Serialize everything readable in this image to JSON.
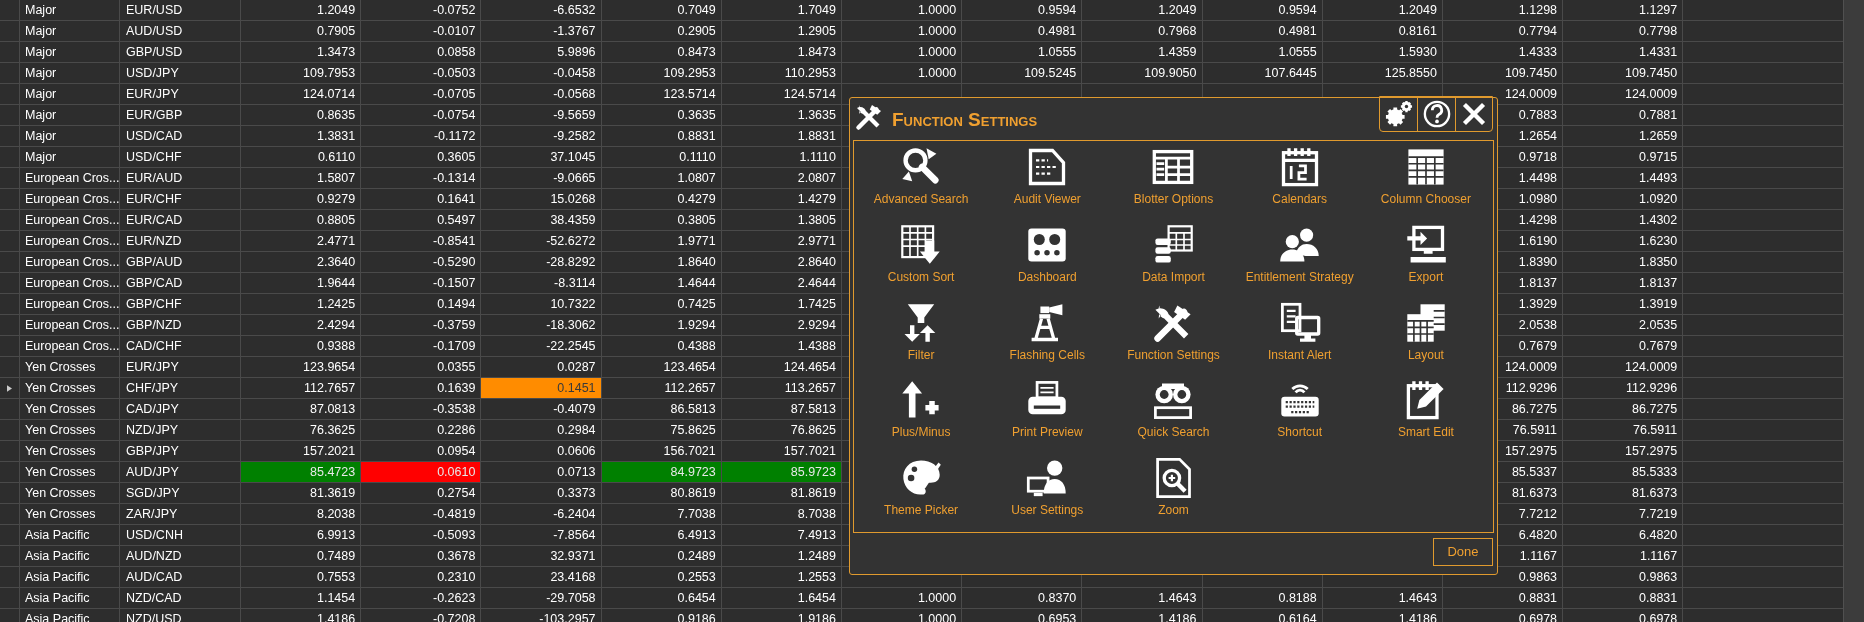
{
  "table": {
    "rows": [
      {
        "category": "Major",
        "pair": "EUR/USD",
        "selected": false,
        "values": [
          "1.2049",
          "-0.0752",
          "-6.6532",
          "0.7049",
          "1.7049"
        ],
        "middle_values": [
          "1.0000",
          "0.9594",
          "1.2049",
          "0.9594",
          "1.2049"
        ],
        "right_values": [
          "1.1298",
          "1.1297"
        ]
      },
      {
        "category": "Major",
        "pair": "AUD/USD",
        "selected": false,
        "values": [
          "0.7905",
          "-0.0107",
          "-1.3767",
          "0.2905",
          "1.2905"
        ],
        "middle_values": [
          "1.0000",
          "0.4981",
          "0.7968",
          "0.4981",
          "0.8161"
        ],
        "right_values": [
          "0.7794",
          "0.7798"
        ]
      },
      {
        "category": "Major",
        "pair": "GBP/USD",
        "selected": false,
        "values": [
          "1.3473",
          "0.0858",
          "5.9896",
          "0.8473",
          "1.8473"
        ],
        "middle_values": [
          "1.0000",
          "1.0555",
          "1.4359",
          "1.0555",
          "1.5930"
        ],
        "right_values": [
          "1.4333",
          "1.4331"
        ]
      },
      {
        "category": "Major",
        "pair": "USD/JPY",
        "selected": false,
        "values": [
          "109.7953",
          "-0.0503",
          "-0.0458",
          "109.2953",
          "110.2953"
        ],
        "middle_values": [
          "1.0000",
          "109.5245",
          "109.9050",
          "107.6445",
          "125.8550"
        ],
        "right_values": [
          "109.7450",
          "109.7450"
        ]
      },
      {
        "category": "Major",
        "pair": "EUR/JPY",
        "selected": false,
        "values": [
          "124.0714",
          "-0.0705",
          "-0.0568",
          "123.5714",
          "124.5714"
        ],
        "right_values": [
          "124.0009",
          "124.0009"
        ]
      },
      {
        "category": "Major",
        "pair": "EUR/GBP",
        "selected": false,
        "values": [
          "0.8635",
          "-0.0754",
          "-9.5659",
          "0.3635",
          "1.3635"
        ],
        "right_values": [
          "0.7883",
          "0.7881"
        ]
      },
      {
        "category": "Major",
        "pair": "USD/CAD",
        "selected": false,
        "values": [
          "1.3831",
          "-0.1172",
          "-9.2582",
          "0.8831",
          "1.8831"
        ],
        "right_values": [
          "1.2654",
          "1.2659"
        ]
      },
      {
        "category": "Major",
        "pair": "USD/CHF",
        "selected": false,
        "values": [
          "0.6110",
          "0.3605",
          "37.1045",
          "0.1110",
          "1.1110"
        ],
        "right_values": [
          "0.9718",
          "0.9715"
        ]
      },
      {
        "category": "European Cros...",
        "pair": "EUR/AUD",
        "selected": false,
        "values": [
          "1.5807",
          "-0.1314",
          "-9.0665",
          "1.0807",
          "2.0807"
        ],
        "right_values": [
          "1.4498",
          "1.4493"
        ]
      },
      {
        "category": "European Cros...",
        "pair": "EUR/CHF",
        "selected": false,
        "values": [
          "0.9279",
          "0.1641",
          "15.0268",
          "0.4279",
          "1.4279"
        ],
        "right_values": [
          "1.0980",
          "1.0920"
        ]
      },
      {
        "category": "European Cros...",
        "pair": "EUR/CAD",
        "selected": false,
        "values": [
          "0.8805",
          "0.5497",
          "38.4359",
          "0.3805",
          "1.3805"
        ],
        "right_values": [
          "1.4298",
          "1.4302"
        ]
      },
      {
        "category": "European Cros...",
        "pair": "EUR/NZD",
        "selected": false,
        "values": [
          "2.4771",
          "-0.8541",
          "-52.6272",
          "1.9771",
          "2.9771"
        ],
        "right_values": [
          "1.6190",
          "1.6230"
        ]
      },
      {
        "category": "European Cros...",
        "pair": "GBP/AUD",
        "selected": false,
        "values": [
          "2.3640",
          "-0.5290",
          "-28.8292",
          "1.8640",
          "2.8640"
        ],
        "right_values": [
          "1.8390",
          "1.8350"
        ]
      },
      {
        "category": "European Cros...",
        "pair": "GBP/CAD",
        "selected": false,
        "values": [
          "1.9644",
          "-0.1507",
          "-8.3114",
          "1.4644",
          "2.4644"
        ],
        "right_values": [
          "1.8137",
          "1.8137"
        ]
      },
      {
        "category": "European Cros...",
        "pair": "GBP/CHF",
        "selected": false,
        "values": [
          "1.2425",
          "0.1494",
          "10.7322",
          "0.7425",
          "1.7425"
        ],
        "right_values": [
          "1.3929",
          "1.3919"
        ]
      },
      {
        "category": "European Cros...",
        "pair": "GBP/NZD",
        "selected": false,
        "values": [
          "2.4294",
          "-0.3759",
          "-18.3062",
          "1.9294",
          "2.9294"
        ],
        "right_values": [
          "2.0538",
          "2.0535"
        ]
      },
      {
        "category": "European Cros...",
        "pair": "CAD/CHF",
        "selected": false,
        "values": [
          "0.9388",
          "-0.1709",
          "-22.2545",
          "0.4388",
          "1.4388"
        ],
        "right_values": [
          "0.7679",
          "0.7679"
        ]
      },
      {
        "category": "Yen Crosses",
        "pair": "EUR/JPY",
        "selected": false,
        "values": [
          "123.9654",
          "0.0355",
          "0.0287",
          "123.4654",
          "124.4654"
        ],
        "right_values": [
          "124.0009",
          "124.0009"
        ]
      },
      {
        "category": "Yen Crosses",
        "pair": "CHF/JPY",
        "selected": true,
        "values": [
          "112.7657",
          "0.1639",
          {
            "text": "0.1451",
            "color": "#ff8c00"
          },
          "112.2657",
          "113.2657"
        ],
        "right_values": [
          "112.9296",
          "112.9296"
        ]
      },
      {
        "category": "Yen Crosses",
        "pair": "CAD/JPY",
        "selected": false,
        "values": [
          "87.0813",
          "-0.3538",
          "-0.4079",
          "86.5813",
          "87.5813"
        ],
        "right_values": [
          "86.7275",
          "86.7275"
        ]
      },
      {
        "category": "Yen Crosses",
        "pair": "NZD/JPY",
        "selected": false,
        "values": [
          "76.3625",
          "0.2286",
          "0.2984",
          "75.8625",
          "76.8625"
        ],
        "right_values": [
          "76.5911",
          "76.5911"
        ]
      },
      {
        "category": "Yen Crosses",
        "pair": "GBP/JPY",
        "selected": false,
        "values": [
          "157.2021",
          "0.0954",
          "0.0606",
          "156.7021",
          "157.7021"
        ],
        "right_values": [
          "157.2975",
          "157.2975"
        ]
      },
      {
        "category": "Yen Crosses",
        "pair": "AUD/JPY",
        "selected": false,
        "values": [
          {
            "text": "85.4723",
            "color": "#008000"
          },
          {
            "text": "0.0610",
            "color": "#ff0000"
          },
          "0.0713",
          {
            "text": "84.9723",
            "color": "#008000"
          },
          {
            "text": "85.9723",
            "color": "#008000"
          }
        ],
        "right_values": [
          "85.5337",
          "85.5333"
        ]
      },
      {
        "category": "Yen Crosses",
        "pair": "SGD/JPY",
        "selected": false,
        "values": [
          "81.3619",
          "0.2754",
          "0.3373",
          "80.8619",
          "81.8619"
        ],
        "right_values": [
          "81.6373",
          "81.6373"
        ]
      },
      {
        "category": "Yen Crosses",
        "pair": "ZAR/JPY",
        "selected": false,
        "values": [
          "8.2038",
          "-0.4819",
          "-6.2404",
          "7.7038",
          "8.7038"
        ],
        "right_values": [
          "7.7212",
          "7.7219"
        ]
      },
      {
        "category": "Asia Pacific",
        "pair": "USD/CNH",
        "selected": false,
        "values": [
          "6.9913",
          "-0.5093",
          "-7.8564",
          "6.4913",
          "7.4913"
        ],
        "right_values": [
          "6.4820",
          "6.4820"
        ]
      },
      {
        "category": "Asia Pacific",
        "pair": "AUD/NZD",
        "selected": false,
        "values": [
          "0.7489",
          "0.3678",
          "32.9371",
          "0.2489",
          "1.2489"
        ],
        "right_values": [
          "1.1167",
          "1.1167"
        ]
      },
      {
        "category": "Asia Pacific",
        "pair": "AUD/CAD",
        "selected": false,
        "values": [
          "0.7553",
          "0.2310",
          "23.4168",
          "0.2553",
          "1.2553"
        ],
        "right_values": [
          "0.9863",
          "0.9863"
        ]
      },
      {
        "category": "Asia Pacific",
        "pair": "NZD/CAD",
        "selected": false,
        "values": [
          "1.1454",
          "-0.2623",
          "-29.7058",
          "0.6454",
          "1.6454"
        ],
        "middle_values": [
          "1.0000",
          "0.8370",
          "1.4643",
          "0.8188",
          "1.4643"
        ],
        "right_values": [
          "0.8831",
          "0.8831"
        ]
      },
      {
        "category": "Asia Pacific",
        "pair": "NZD/USD",
        "selected": false,
        "values": [
          "1.4186",
          "-0.7208",
          "-103.2957",
          "0.9186",
          "1.9186"
        ],
        "middle_values": [
          "1.0000",
          "0.6953",
          "1.4186",
          "0.6164",
          "1.4186"
        ],
        "right_values": [
          "0.6978",
          "0.6978"
        ]
      }
    ]
  },
  "dialog": {
    "title": "Function Settings",
    "items": [
      {
        "label": "Advanced Search"
      },
      {
        "label": "Audit Viewer"
      },
      {
        "label": "Blotter Options"
      },
      {
        "label": "Calendars"
      },
      {
        "label": "Column Chooser"
      },
      {
        "label": "Custom Sort"
      },
      {
        "label": "Dashboard"
      },
      {
        "label": "Data Import"
      },
      {
        "label": "Entitlement Strategy"
      },
      {
        "label": "Export"
      },
      {
        "label": "Filter"
      },
      {
        "label": "Flashing Cells"
      },
      {
        "label": "Function Settings"
      },
      {
        "label": "Instant Alert"
      },
      {
        "label": "Layout"
      },
      {
        "label": "Plus/Minus"
      },
      {
        "label": "Print Preview"
      },
      {
        "label": "Quick Search"
      },
      {
        "label": "Shortcut"
      },
      {
        "label": "Smart Edit"
      },
      {
        "label": "Theme Picker"
      },
      {
        "label": "User Settings"
      },
      {
        "label": "Zoom"
      }
    ],
    "done_button": "Done"
  }
}
